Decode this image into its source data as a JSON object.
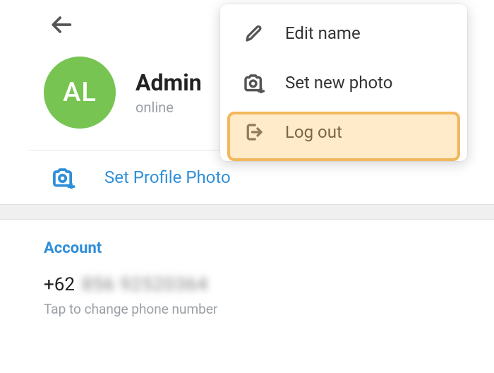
{
  "profile": {
    "avatar_initials": "AL",
    "name": "Admin",
    "status": "online"
  },
  "actions": {
    "set_profile_photo": "Set Profile Photo"
  },
  "account": {
    "section_title": "Account",
    "phone_prefix": "+62",
    "phone_blurred": "856 92520364",
    "phone_hint": "Tap to change phone number"
  },
  "menu": {
    "edit_name": "Edit name",
    "set_new_photo": "Set new photo",
    "log_out": "Log out"
  },
  "colors": {
    "accent": "#2f8fd9",
    "avatar_bg": "#78c452",
    "highlight_border": "#f2b75c"
  }
}
